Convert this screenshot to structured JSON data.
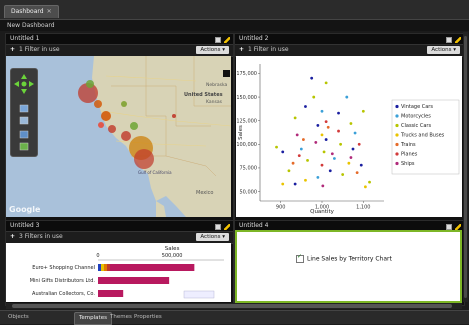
{
  "tabs": {
    "dashboard": "Dashboard",
    "close": "✕"
  },
  "subbar": {
    "title": "New Dashboard"
  },
  "panels": {
    "p1": {
      "title": "Untitled 1",
      "filter": "1 Filter in use",
      "actions": "Actions ▾"
    },
    "p2": {
      "title": "Untitled 2",
      "filter": "1 Filter in use",
      "actions": "Actions ▾"
    },
    "p3": {
      "title": "Untitled 3",
      "filter": "3 Filters in use",
      "actions": "Actions ▾"
    },
    "p4": {
      "title": "Untitled 4",
      "checkbox_label": "Line Sales by Territory Chart"
    }
  },
  "map": {
    "labels": [
      "United States",
      "Nebraska",
      "Kansas",
      "Mexico",
      "Gulf of California",
      "Google"
    ],
    "colors": {
      "water": "#a9c1da",
      "land": "#d8d3b6"
    }
  },
  "bottom": {
    "objects": "Objects",
    "templates": "Templates",
    "themes": "Themes",
    "properties": "Properties"
  },
  "chart_data": [
    {
      "type": "scatter",
      "xlabel": "Quantity",
      "ylabel": "Sales",
      "xlim": [
        850,
        1150
      ],
      "ylim": [
        40000,
        185000
      ],
      "x_ticks": [
        "900",
        "1,000",
        "1,100"
      ],
      "x_tick_values": [
        900,
        1000,
        1100
      ],
      "y_ticks": [
        "50,000",
        "75,000",
        "100,000",
        "125,000",
        "150,000",
        "175,000"
      ],
      "y_tick_values": [
        50000,
        75000,
        100000,
        125000,
        150000,
        175000
      ],
      "legend_position": "right",
      "series": [
        {
          "name": "Vintage Cars",
          "color": "#1a1fa0",
          "points": [
            [
              905,
              92000
            ],
            [
              960,
              140000
            ],
            [
              990,
              120000
            ],
            [
              1010,
              105000
            ],
            [
              1040,
              133000
            ],
            [
              1075,
              95000
            ],
            [
              1095,
              78000
            ],
            [
              935,
              58000
            ],
            [
              1020,
              72000
            ],
            [
              975,
              170000
            ]
          ]
        },
        {
          "name": "Motorcycles",
          "color": "#3ba0d8",
          "points": [
            [
              950,
              95000
            ],
            [
              1000,
              135000
            ],
            [
              1060,
              150000
            ],
            [
              990,
              65000
            ],
            [
              1030,
              85000
            ],
            [
              1080,
              112000
            ]
          ]
        },
        {
          "name": "Classic Cars",
          "color": "#b7c500",
          "points": [
            [
              890,
              97000
            ],
            [
              935,
              128000
            ],
            [
              980,
              150000
            ],
            [
              1010,
              165000
            ],
            [
              1045,
              100000
            ],
            [
              1070,
              122000
            ],
            [
              1100,
              135000
            ],
            [
              920,
              72000
            ],
            [
              965,
              83000
            ],
            [
              1005,
              92000
            ],
            [
              1050,
              68000
            ],
            [
              1115,
              60000
            ]
          ]
        },
        {
          "name": "Trucks and Buses",
          "color": "#e9c400",
          "points": [
            [
              905,
              58000
            ],
            [
              960,
              62000
            ],
            [
              1000,
              110000
            ],
            [
              1065,
              80000
            ],
            [
              1105,
              55000
            ]
          ]
        },
        {
          "name": "Trains",
          "color": "#e56b2a",
          "points": [
            [
              955,
              105000
            ],
            [
              1015,
              118000
            ],
            [
              1085,
              70000
            ],
            [
              930,
              80000
            ]
          ]
        },
        {
          "name": "Planes",
          "color": "#d23a3a",
          "points": [
            [
              945,
              88000
            ],
            [
              1000,
              78000
            ],
            [
              1040,
              114000
            ],
            [
              1010,
              124000
            ],
            [
              1090,
              100000
            ]
          ]
        },
        {
          "name": "Ships",
          "color": "#b02a7a",
          "points": [
            [
              940,
              110000
            ],
            [
              985,
              102000
            ],
            [
              1025,
              90000
            ],
            [
              1070,
              86000
            ],
            [
              1002,
              56000
            ]
          ]
        }
      ]
    },
    {
      "type": "bar",
      "title": "Sales",
      "x_ticks": [
        "0",
        "500,000"
      ],
      "x_tick_values": [
        0,
        500000
      ],
      "categories": [
        "Euro+ Shopping Channel",
        "Mini Gifts Distributors Ltd.",
        "Australian Collectors, Co."
      ],
      "values": [
        650000,
        480000,
        170000
      ],
      "colors": [
        "#b8195f",
        "#b8195f",
        "#b8195f"
      ]
    }
  ]
}
